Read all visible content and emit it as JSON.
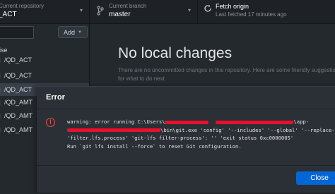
{
  "toolbar": {
    "repository": {
      "small_label": "Current repository",
      "value": "_ACT"
    },
    "branch": {
      "small_label": "Current branch",
      "value": "master"
    },
    "fetch": {
      "title": "Fetch origin",
      "subtitle": "Last fetched 17 minutes ago"
    }
  },
  "sidebar": {
    "add_label": "Add",
    "group_label": "ise",
    "items": [
      {
        "label": "/QD_ACT",
        "selected": false
      },
      {
        "label": "/QD_ACT",
        "selected": false
      },
      {
        "label": "/QD_ACT",
        "selected": true
      },
      {
        "label": "/QD_AMT",
        "selected": false
      },
      {
        "label": "/QD_AMT",
        "selected": false
      },
      {
        "label": "/QD_AMT",
        "selected": false
      }
    ]
  },
  "main": {
    "title": "No local changes",
    "description": "There are no uncommitted changes in this repository. Here are some friendly suggestions for what to do next."
  },
  "dialog": {
    "title": "Error",
    "lines": {
      "l1_a": "warning: error running C:\\Users\\",
      "l1_b": "\\app-",
      "l2_a": "\\bin\\git.exe 'config' '--includes' '--global' '--replace-",
      "l3": "'filter.lfs.process' 'git-lfs filter-process': '' 'exit status 0xc0000005'",
      "l4": "Run `git lfs install --force` to reset Git configuration."
    },
    "close_label": "Close"
  },
  "colors": {
    "accent": "#0366d6",
    "error": "#e5534b",
    "redaction": "#e8102a"
  }
}
